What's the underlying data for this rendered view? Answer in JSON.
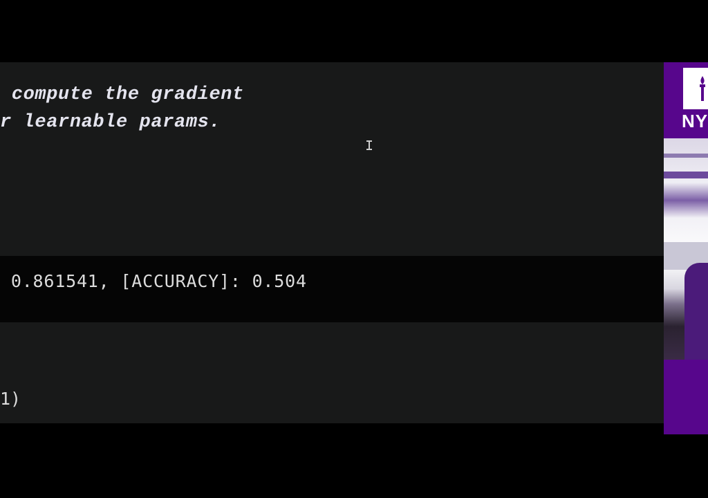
{
  "notebook": {
    "code_cell_top": {
      "lines": [
        " compute the gradient",
        "r learnable params."
      ]
    },
    "output_cell": {
      "text": " 0.861541, [ACCURACY]: 0.504"
    },
    "code_cell_bottom": {
      "text": "1)"
    }
  },
  "side_panel": {
    "logo_text": "NYU",
    "brand_color": "#57068c"
  },
  "cursor": {
    "icon": "text-cursor-icon"
  }
}
